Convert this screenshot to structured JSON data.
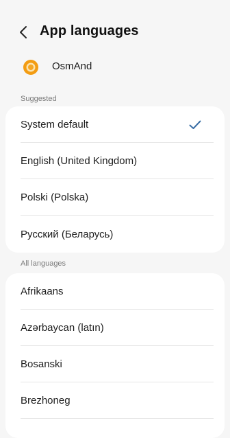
{
  "header": {
    "back_icon": "chevron-left-icon",
    "title": "App languages"
  },
  "app": {
    "icon": "osmand-app-icon",
    "name": "OsmAnd"
  },
  "suggested": {
    "label": "Suggested",
    "items": [
      {
        "label": "System default",
        "selected": true
      },
      {
        "label": "English (United Kingdom)",
        "selected": false
      },
      {
        "label": "Polski (Polska)",
        "selected": false
      },
      {
        "label": "Русский (Беларусь)",
        "selected": false
      }
    ]
  },
  "all_languages": {
    "label": "All languages",
    "items": [
      {
        "label": "Afrikaans"
      },
      {
        "label": "Azərbaycan (latın)"
      },
      {
        "label": "Bosanski"
      },
      {
        "label": "Brezhoneg"
      }
    ]
  },
  "colors": {
    "background": "#f6f6f6",
    "card": "#ffffff",
    "accent_check": "#3a6ea5",
    "app_icon_orange": "#f39c12"
  }
}
